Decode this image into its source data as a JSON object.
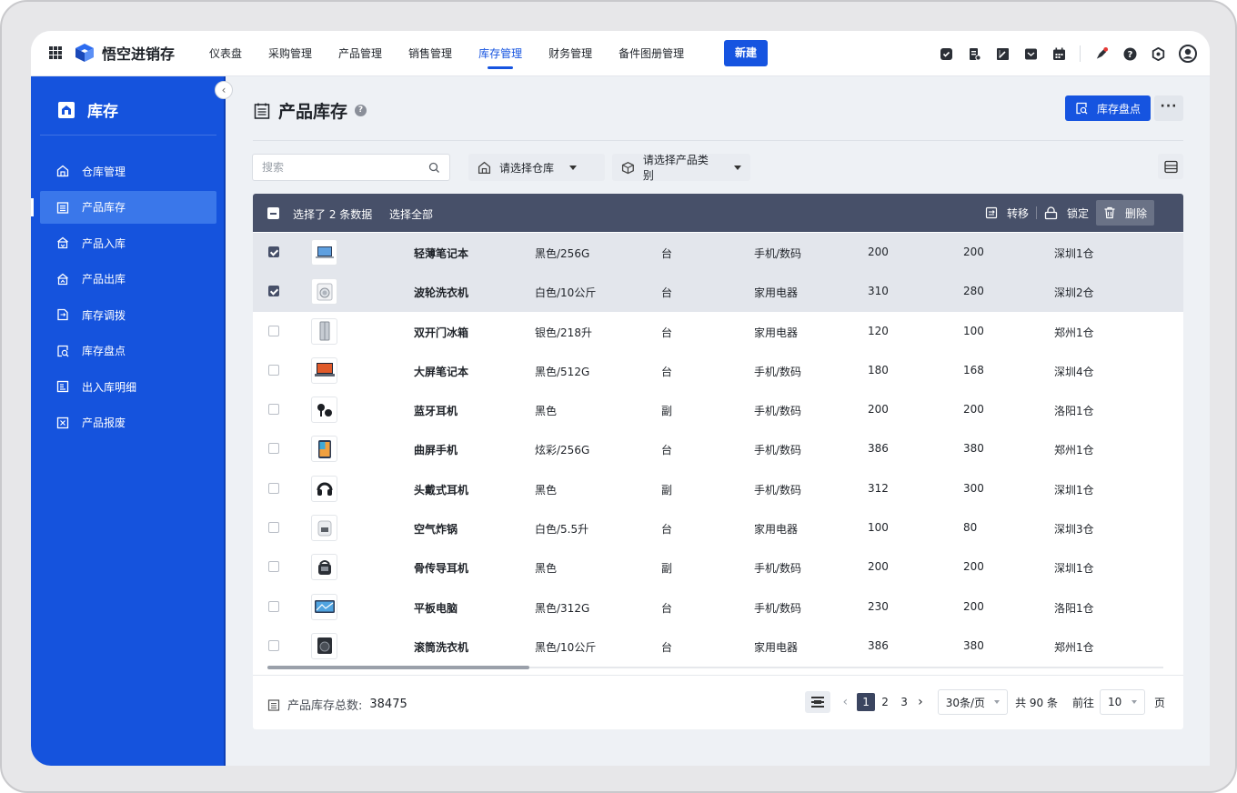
{
  "app": {
    "name": "悟空进销存"
  },
  "nav": {
    "items": [
      "仪表盘",
      "采购管理",
      "产品管理",
      "销售管理",
      "库存管理",
      "财务管理",
      "备件图册管理"
    ],
    "active": "库存管理",
    "new_label": "新建"
  },
  "top_icons": [
    "checklist-icon",
    "receipt-icon",
    "edit-doc-icon",
    "message-icon",
    "calendar-icon",
    "rocket-icon",
    "help-icon",
    "settings-icon",
    "user-avatar-icon"
  ],
  "sidebar": {
    "title": "库存",
    "items": [
      {
        "label": "仓库管理",
        "icon": "warehouse-icon"
      },
      {
        "label": "产品库存",
        "icon": "inventory-list-icon",
        "active": true
      },
      {
        "label": "产品入库",
        "icon": "stock-in-icon"
      },
      {
        "label": "产品出库",
        "icon": "stock-out-icon"
      },
      {
        "label": "库存调拨",
        "icon": "transfer-doc-icon"
      },
      {
        "label": "库存盘点",
        "icon": "stocktake-icon"
      },
      {
        "label": "出入库明细",
        "icon": "detail-list-icon"
      },
      {
        "label": "产品报废",
        "icon": "scrap-icon"
      }
    ]
  },
  "page": {
    "title": "产品库存",
    "stocktake_label": "库存盘点",
    "more_label": "···"
  },
  "filters": {
    "search_placeholder": "搜索",
    "warehouse_placeholder": "请选择仓库",
    "category_placeholder": "请选择产品类别"
  },
  "bulk": {
    "selected_text": "选择了 2 条数据",
    "select_all": "选择全部",
    "transfer": "转移",
    "lock": "锁定",
    "delete": "删除"
  },
  "rows": [
    {
      "selected": true,
      "name": "轻薄笔记本",
      "spec": "黑色/256G",
      "unit": "台",
      "category": "手机/数码",
      "q1": "200",
      "q2": "200",
      "warehouse": "深圳1仓",
      "img": "laptop"
    },
    {
      "selected": true,
      "name": "波轮洗衣机",
      "spec": "白色/10公斤",
      "unit": "台",
      "category": "家用电器",
      "q1": "310",
      "q2": "280",
      "warehouse": "深圳2仓",
      "img": "washer-white"
    },
    {
      "selected": false,
      "name": "双开门冰箱",
      "spec": "银色/218升",
      "unit": "台",
      "category": "家用电器",
      "q1": "120",
      "q2": "100",
      "warehouse": "郑州1仓",
      "img": "fridge"
    },
    {
      "selected": false,
      "name": "大屏笔记本",
      "spec": "黑色/512G",
      "unit": "台",
      "category": "手机/数码",
      "q1": "180",
      "q2": "168",
      "warehouse": "深圳4仓",
      "img": "laptop-big"
    },
    {
      "selected": false,
      "name": "蓝牙耳机",
      "spec": "黑色",
      "unit": "副",
      "category": "手机/数码",
      "q1": "200",
      "q2": "200",
      "warehouse": "洛阳1仓",
      "img": "earbuds"
    },
    {
      "selected": false,
      "name": "曲屏手机",
      "spec": "炫彩/256G",
      "unit": "台",
      "category": "手机/数码",
      "q1": "386",
      "q2": "380",
      "warehouse": "郑州1仓",
      "img": "phone"
    },
    {
      "selected": false,
      "name": "头戴式耳机",
      "spec": "黑色",
      "unit": "副",
      "category": "手机/数码",
      "q1": "312",
      "q2": "300",
      "warehouse": "深圳1仓",
      "img": "headphones"
    },
    {
      "selected": false,
      "name": "空气炸锅",
      "spec": "白色/5.5升",
      "unit": "台",
      "category": "家用电器",
      "q1": "100",
      "q2": "80",
      "warehouse": "深圳3仓",
      "img": "airfryer"
    },
    {
      "selected": false,
      "name": "骨传导耳机",
      "spec": "黑色",
      "unit": "副",
      "category": "手机/数码",
      "q1": "200",
      "q2": "200",
      "warehouse": "深圳1仓",
      "img": "bone-headset"
    },
    {
      "selected": false,
      "name": "平板电脑",
      "spec": "黑色/312G",
      "unit": "台",
      "category": "手机/数码",
      "q1": "230",
      "q2": "200",
      "warehouse": "洛阳1仓",
      "img": "tablet"
    },
    {
      "selected": false,
      "name": "滚筒洗衣机",
      "spec": "黑色/10公斤",
      "unit": "台",
      "category": "家用电器",
      "q1": "386",
      "q2": "380",
      "warehouse": "郑州1仓",
      "img": "washer-dark"
    }
  ],
  "footer": {
    "total_label": "产品库存总数:",
    "total_value": "38475",
    "pages": [
      "1",
      "2",
      "3"
    ],
    "current_page": "1",
    "page_size": "30条/页",
    "total_count": "共 90 条",
    "goto_label": "前往",
    "goto_value": "10",
    "page_suffix": "页"
  },
  "colors": {
    "primary": "#1654e0",
    "sidebar": "#1553dd",
    "bulk_bar": "#475069",
    "selected_row": "#e3e6ec"
  }
}
